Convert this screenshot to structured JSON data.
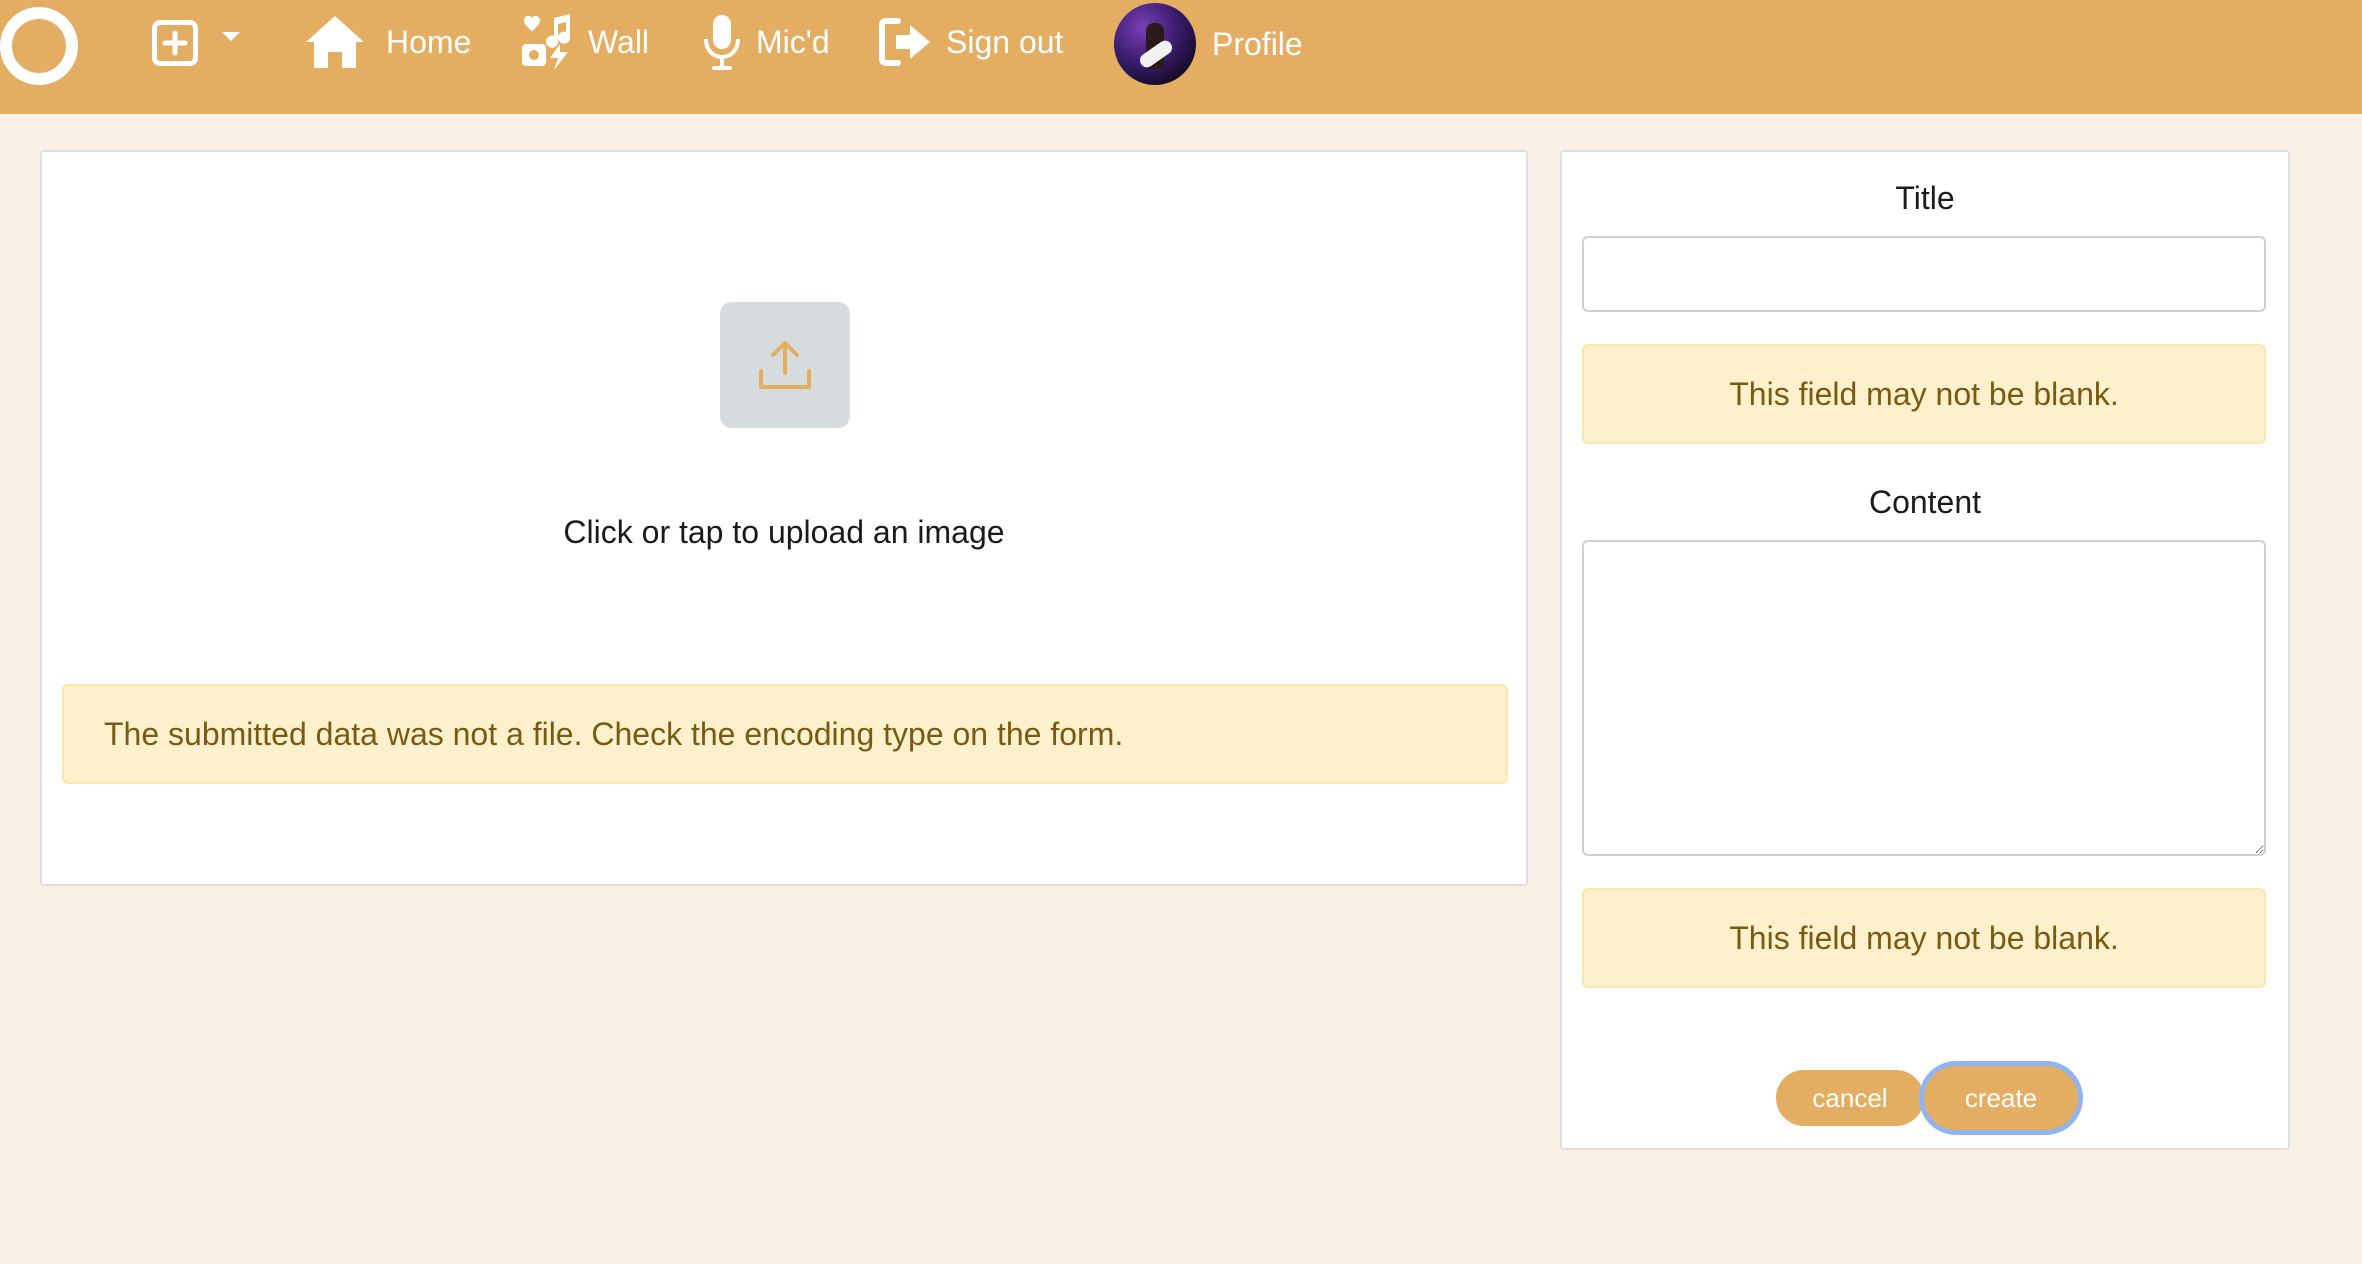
{
  "nav": {
    "logo_icon": "ring-logo-icon",
    "add_icon": "plus-square-icon",
    "items": [
      {
        "label": "Home",
        "icon": "house-icon"
      },
      {
        "label": "Wall",
        "icon": "music-notes-icon"
      },
      {
        "label": "Mic'd",
        "icon": "microphone-icon"
      },
      {
        "label": "Sign out",
        "icon": "sign-out-icon"
      },
      {
        "label": "Profile",
        "icon": "avatar"
      }
    ]
  },
  "upload": {
    "icon": "upload-icon",
    "prompt": "Click or tap to upload an image",
    "error": "The submitted data was not a file. Check the encoding type on the form."
  },
  "form": {
    "title_label": "Title",
    "title_value": "",
    "title_error": "This field may not be blank.",
    "content_label": "Content",
    "content_value": "",
    "content_error": "This field may not be blank.",
    "cancel_label": "cancel",
    "create_label": "create"
  },
  "colors": {
    "navbar": "#e3ae62",
    "background": "#f9f1e6",
    "alert_bg": "#fdf1cd",
    "alert_text": "#7a5a10",
    "button": "#e3ae62",
    "focus_ring": "#8fb4f0"
  }
}
